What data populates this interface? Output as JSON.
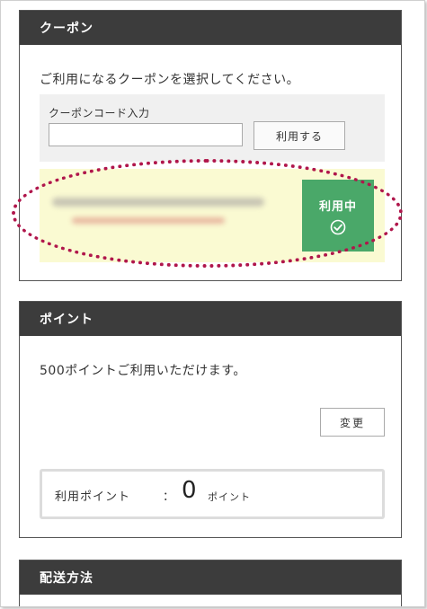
{
  "coupon": {
    "header": "クーポン",
    "instruction": "ご利用になるクーポンを選択してください。",
    "code_label": "クーポンコード入力",
    "code_value": "",
    "apply_button": "利用する",
    "in_use_label": "利用中",
    "in_use_icon": "check-circle-icon"
  },
  "points": {
    "header": "ポイント",
    "available_text": "500ポイントご利用いただけます。",
    "change_button": "変更",
    "use_label": "利用ポイント",
    "colon": "：",
    "value": "0",
    "unit": "ポイント"
  },
  "shipping": {
    "header": "配送方法"
  },
  "colors": {
    "header_bg": "#3c3c3c",
    "in_use_green": "#4aa869",
    "highlight_row": "#fafad2",
    "annotation_oval": "#b0164b"
  }
}
